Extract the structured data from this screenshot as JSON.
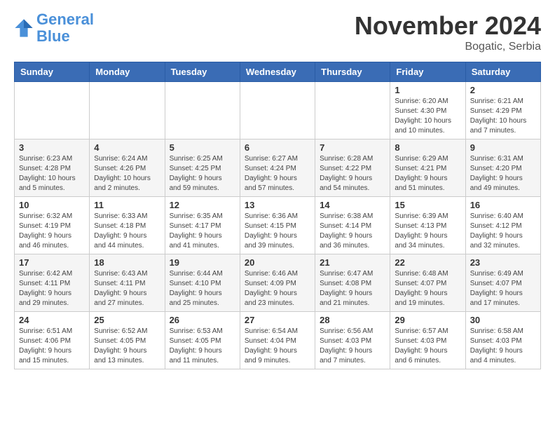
{
  "header": {
    "logo_line1": "General",
    "logo_line2": "Blue",
    "month": "November 2024",
    "location": "Bogatic, Serbia"
  },
  "days_of_week": [
    "Sunday",
    "Monday",
    "Tuesday",
    "Wednesday",
    "Thursday",
    "Friday",
    "Saturday"
  ],
  "weeks": [
    [
      {
        "day": "",
        "info": ""
      },
      {
        "day": "",
        "info": ""
      },
      {
        "day": "",
        "info": ""
      },
      {
        "day": "",
        "info": ""
      },
      {
        "day": "",
        "info": ""
      },
      {
        "day": "1",
        "info": "Sunrise: 6:20 AM\nSunset: 4:30 PM\nDaylight: 10 hours and 10 minutes."
      },
      {
        "day": "2",
        "info": "Sunrise: 6:21 AM\nSunset: 4:29 PM\nDaylight: 10 hours and 7 minutes."
      }
    ],
    [
      {
        "day": "3",
        "info": "Sunrise: 6:23 AM\nSunset: 4:28 PM\nDaylight: 10 hours and 5 minutes."
      },
      {
        "day": "4",
        "info": "Sunrise: 6:24 AM\nSunset: 4:26 PM\nDaylight: 10 hours and 2 minutes."
      },
      {
        "day": "5",
        "info": "Sunrise: 6:25 AM\nSunset: 4:25 PM\nDaylight: 9 hours and 59 minutes."
      },
      {
        "day": "6",
        "info": "Sunrise: 6:27 AM\nSunset: 4:24 PM\nDaylight: 9 hours and 57 minutes."
      },
      {
        "day": "7",
        "info": "Sunrise: 6:28 AM\nSunset: 4:22 PM\nDaylight: 9 hours and 54 minutes."
      },
      {
        "day": "8",
        "info": "Sunrise: 6:29 AM\nSunset: 4:21 PM\nDaylight: 9 hours and 51 minutes."
      },
      {
        "day": "9",
        "info": "Sunrise: 6:31 AM\nSunset: 4:20 PM\nDaylight: 9 hours and 49 minutes."
      }
    ],
    [
      {
        "day": "10",
        "info": "Sunrise: 6:32 AM\nSunset: 4:19 PM\nDaylight: 9 hours and 46 minutes."
      },
      {
        "day": "11",
        "info": "Sunrise: 6:33 AM\nSunset: 4:18 PM\nDaylight: 9 hours and 44 minutes."
      },
      {
        "day": "12",
        "info": "Sunrise: 6:35 AM\nSunset: 4:17 PM\nDaylight: 9 hours and 41 minutes."
      },
      {
        "day": "13",
        "info": "Sunrise: 6:36 AM\nSunset: 4:15 PM\nDaylight: 9 hours and 39 minutes."
      },
      {
        "day": "14",
        "info": "Sunrise: 6:38 AM\nSunset: 4:14 PM\nDaylight: 9 hours and 36 minutes."
      },
      {
        "day": "15",
        "info": "Sunrise: 6:39 AM\nSunset: 4:13 PM\nDaylight: 9 hours and 34 minutes."
      },
      {
        "day": "16",
        "info": "Sunrise: 6:40 AM\nSunset: 4:12 PM\nDaylight: 9 hours and 32 minutes."
      }
    ],
    [
      {
        "day": "17",
        "info": "Sunrise: 6:42 AM\nSunset: 4:11 PM\nDaylight: 9 hours and 29 minutes."
      },
      {
        "day": "18",
        "info": "Sunrise: 6:43 AM\nSunset: 4:11 PM\nDaylight: 9 hours and 27 minutes."
      },
      {
        "day": "19",
        "info": "Sunrise: 6:44 AM\nSunset: 4:10 PM\nDaylight: 9 hours and 25 minutes."
      },
      {
        "day": "20",
        "info": "Sunrise: 6:46 AM\nSunset: 4:09 PM\nDaylight: 9 hours and 23 minutes."
      },
      {
        "day": "21",
        "info": "Sunrise: 6:47 AM\nSunset: 4:08 PM\nDaylight: 9 hours and 21 minutes."
      },
      {
        "day": "22",
        "info": "Sunrise: 6:48 AM\nSunset: 4:07 PM\nDaylight: 9 hours and 19 minutes."
      },
      {
        "day": "23",
        "info": "Sunrise: 6:49 AM\nSunset: 4:07 PM\nDaylight: 9 hours and 17 minutes."
      }
    ],
    [
      {
        "day": "24",
        "info": "Sunrise: 6:51 AM\nSunset: 4:06 PM\nDaylight: 9 hours and 15 minutes."
      },
      {
        "day": "25",
        "info": "Sunrise: 6:52 AM\nSunset: 4:05 PM\nDaylight: 9 hours and 13 minutes."
      },
      {
        "day": "26",
        "info": "Sunrise: 6:53 AM\nSunset: 4:05 PM\nDaylight: 9 hours and 11 minutes."
      },
      {
        "day": "27",
        "info": "Sunrise: 6:54 AM\nSunset: 4:04 PM\nDaylight: 9 hours and 9 minutes."
      },
      {
        "day": "28",
        "info": "Sunrise: 6:56 AM\nSunset: 4:03 PM\nDaylight: 9 hours and 7 minutes."
      },
      {
        "day": "29",
        "info": "Sunrise: 6:57 AM\nSunset: 4:03 PM\nDaylight: 9 hours and 6 minutes."
      },
      {
        "day": "30",
        "info": "Sunrise: 6:58 AM\nSunset: 4:03 PM\nDaylight: 9 hours and 4 minutes."
      }
    ]
  ]
}
